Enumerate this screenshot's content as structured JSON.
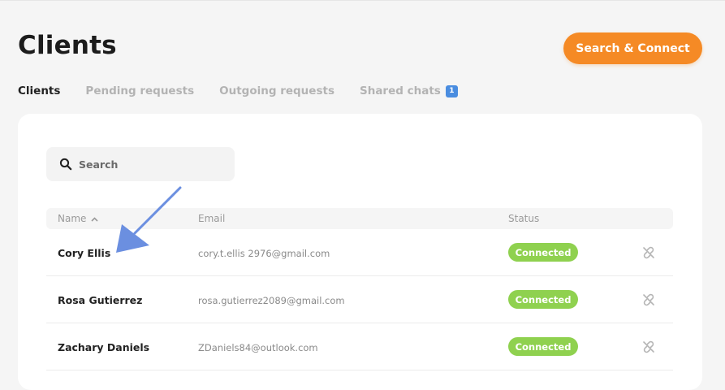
{
  "header": {
    "title": "Clients",
    "cta_label": "Search & Connect"
  },
  "tabs": [
    {
      "label": "Clients",
      "active": true
    },
    {
      "label": "Pending requests",
      "active": false
    },
    {
      "label": "Outgoing requests",
      "active": false
    },
    {
      "label": "Shared chats",
      "active": false,
      "badge": "1"
    }
  ],
  "search": {
    "placeholder": "Search",
    "value": "",
    "icon": "search-icon"
  },
  "table": {
    "columns": {
      "name": "Name",
      "email": "Email",
      "status": "Status"
    },
    "sort": {
      "column": "name",
      "direction": "ascending",
      "icon": "chevron-up-icon"
    },
    "rows": [
      {
        "name": "Cory Ellis",
        "email": "cory.t.ellis 2976@gmail.com",
        "status": "Connected",
        "action_icon": "unlink-icon"
      },
      {
        "name": "Rosa Gutierrez",
        "email": "rosa.gutierrez2089@gmail.com",
        "status": "Connected",
        "action_icon": "unlink-icon"
      },
      {
        "name": "Zachary Daniels",
        "email": "ZDaniels84@outlook.com",
        "status": "Connected",
        "action_icon": "unlink-icon"
      }
    ]
  },
  "annotation": {
    "icon": "pointer-arrow-icon",
    "color": "#6b8fe0"
  },
  "colors": {
    "accent": "#f58a25",
    "connected": "#8fd14f",
    "badge": "#4a8de0"
  }
}
